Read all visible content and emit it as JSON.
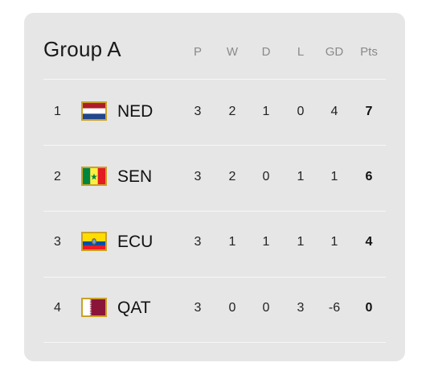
{
  "group": {
    "title": "Group A"
  },
  "columns": [
    "P",
    "W",
    "D",
    "L",
    "GD",
    "Pts"
  ],
  "rows": [
    {
      "rank": "1",
      "team": "NED",
      "flag": "netherlands-flag-icon",
      "P": "3",
      "W": "2",
      "D": "1",
      "L": "0",
      "GD": "4",
      "Pts": "7"
    },
    {
      "rank": "2",
      "team": "SEN",
      "flag": "senegal-flag-icon",
      "P": "3",
      "W": "2",
      "D": "0",
      "L": "1",
      "GD": "1",
      "Pts": "6"
    },
    {
      "rank": "3",
      "team": "ECU",
      "flag": "ecuador-flag-icon",
      "P": "3",
      "W": "1",
      "D": "1",
      "L": "1",
      "GD": "1",
      "Pts": "4"
    },
    {
      "rank": "4",
      "team": "QAT",
      "flag": "qatar-flag-icon",
      "P": "3",
      "W": "0",
      "D": "0",
      "L": "3",
      "GD": "-6",
      "Pts": "0"
    }
  ],
  "colors": {
    "card_bg": "#e6e6e6",
    "flag_border": "#c9a227"
  }
}
